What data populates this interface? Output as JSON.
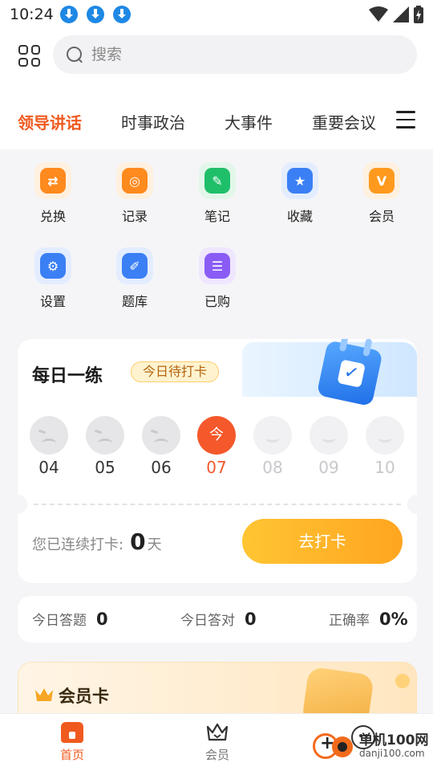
{
  "status_bar": {
    "time": "10:24"
  },
  "search": {
    "placeholder": "搜索"
  },
  "tabs": [
    "领导讲话",
    "时事政治",
    "大事件",
    "重要会议"
  ],
  "shortcuts": [
    {
      "label": "兑换",
      "icon": "exchange-icon",
      "color": "#ff8a1e"
    },
    {
      "label": "记录",
      "icon": "record-icon",
      "color": "#ff8a1e"
    },
    {
      "label": "笔记",
      "icon": "note-icon",
      "color": "#1fbf6a"
    },
    {
      "label": "收藏",
      "icon": "star-icon",
      "color": "#3b7ff5"
    },
    {
      "label": "会员",
      "icon": "vip-icon",
      "color": "#ff9a1e"
    },
    {
      "label": "设置",
      "icon": "settings-icon",
      "color": "#3b7ff5"
    },
    {
      "label": "题库",
      "icon": "question-bank-icon",
      "color": "#3b7ff5"
    },
    {
      "label": "已购",
      "icon": "purchased-icon",
      "color": "#8a5cf5"
    }
  ],
  "daily": {
    "title": "每日一练",
    "badge": "今日待打卡",
    "days": [
      {
        "num": "04",
        "state": "past"
      },
      {
        "num": "05",
        "state": "past"
      },
      {
        "num": "06",
        "state": "past"
      },
      {
        "num": "07",
        "state": "today",
        "face_label": "今"
      },
      {
        "num": "08",
        "state": "future"
      },
      {
        "num": "09",
        "state": "future"
      },
      {
        "num": "10",
        "state": "future"
      }
    ],
    "streak_label": "您已连续打卡:",
    "streak_count": "0",
    "streak_unit": "天",
    "checkin_button": "去打卡"
  },
  "stats": {
    "answered_label": "今日答题",
    "answered_value": "0",
    "correct_label": "今日答对",
    "correct_value": "0",
    "accuracy_label": "正确率",
    "accuracy_value": "0%"
  },
  "vip_card": {
    "title": "会员卡"
  },
  "bottom_nav": {
    "items": [
      {
        "label": "首页",
        "active": true
      },
      {
        "label": "会员",
        "active": false
      }
    ]
  },
  "watermark": {
    "name": "单机100网",
    "url": "danji100.com"
  },
  "colors": {
    "accent": "#f05a1f",
    "checkin_gradient_start": "#ffc533",
    "checkin_gradient_end": "#ffa51f",
    "download_icon": "#1e88e5"
  }
}
